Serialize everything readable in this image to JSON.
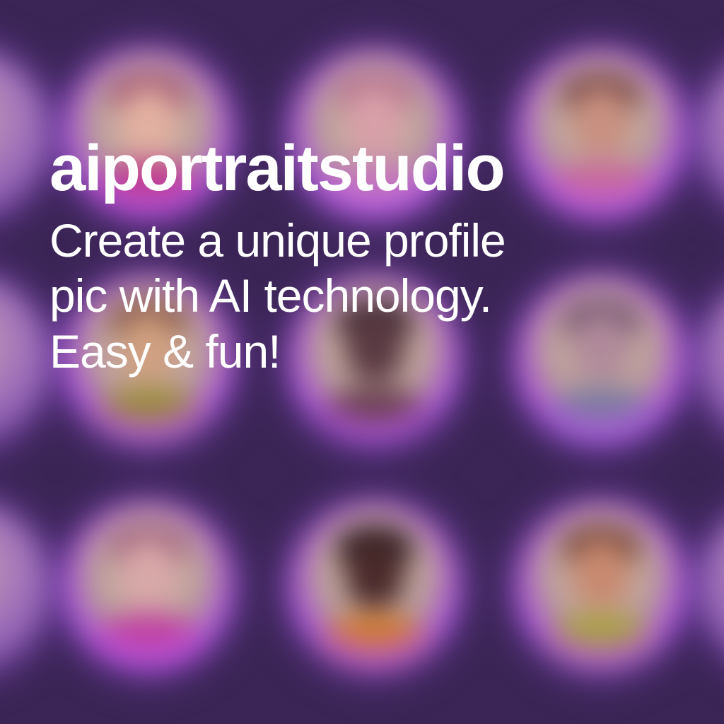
{
  "brand": {
    "name": "aiportraitstudio"
  },
  "tagline": {
    "line1": "Create a unique profile",
    "line2": "pic with AI technology.",
    "line3": "Easy & fun!"
  },
  "colors": {
    "background": "#3b2556",
    "text": "#ffffff",
    "glow": "#a050dc"
  },
  "portraits": [
    {
      "label": "portrait-1",
      "face": "#e2b0a0",
      "hair": "#9b4a6e",
      "body": "#c03a8a"
    },
    {
      "label": "portrait-2",
      "face": "#d8a0a8",
      "hair": "#b06a8a",
      "body": "#c47ab8"
    },
    {
      "label": "portrait-3",
      "face": "#c89080",
      "hair": "#6a3a3a",
      "body": "#c86a9a"
    },
    {
      "label": "portrait-4",
      "face": "#d0a080",
      "hair": "#7a4a3a",
      "body": "#9a8a3a"
    },
    {
      "label": "portrait-5",
      "face": "#5a3a42",
      "hair": "#3a2430",
      "body": "#6a4050"
    },
    {
      "label": "portrait-6",
      "face": "#b08a9a",
      "hair": "#6a4a6a",
      "body": "#7a7aa0"
    },
    {
      "label": "portrait-7",
      "face": "#d8a8a8",
      "hair": "#9a5a7a",
      "body": "#c040a0"
    },
    {
      "label": "portrait-8",
      "face": "#4a2a2a",
      "hair": "#2a1a20",
      "body": "#d07a30"
    },
    {
      "label": "portrait-9",
      "face": "#c88a70",
      "hair": "#6a3a30",
      "body": "#a8a040"
    }
  ]
}
